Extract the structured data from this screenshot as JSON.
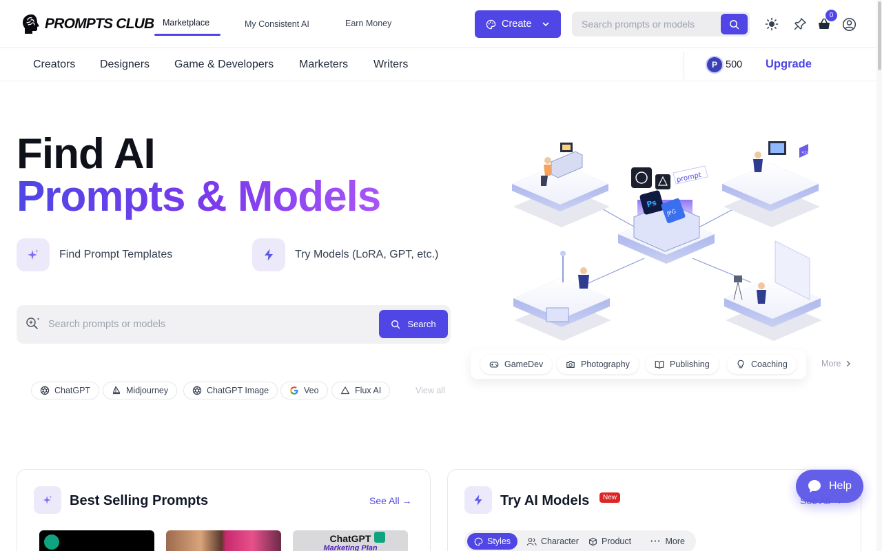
{
  "header": {
    "logo_text": "PROMPTS CLUB",
    "nav_tabs": [
      {
        "label": "Marketplace"
      },
      {
        "label": "My Consistent AI"
      },
      {
        "label": "Earn Money"
      }
    ],
    "create_label": "Create",
    "search_placeholder": "Search prompts or models",
    "cart_count": "0"
  },
  "subnav": {
    "items": [
      "Creators",
      "Designers",
      "Game & Developers",
      "Marketers",
      "Writers"
    ],
    "points": "500",
    "upgrade_label": "Upgrade"
  },
  "hero": {
    "title_line1": "Find AI",
    "title_line2": "Prompts & Models",
    "features": [
      {
        "label": "Find Prompt Templates",
        "icon": "sparkles-icon"
      },
      {
        "label": "Try Models (LoRA, GPT, etc.)",
        "icon": "lightning-icon"
      }
    ],
    "search_placeholder": "Search prompts or models",
    "search_button": "Search",
    "model_chips": [
      {
        "label": "ChatGPT",
        "icon": "openai-icon"
      },
      {
        "label": "Midjourney",
        "icon": "midjourney-icon"
      },
      {
        "label": "ChatGPT Image",
        "icon": "openai-icon"
      },
      {
        "label": "Veo",
        "icon": "google-icon"
      },
      {
        "label": "Flux AI",
        "icon": "triangle-icon"
      }
    ],
    "view_all": "View all"
  },
  "illustration": {
    "labels": [
      "prompt",
      "Ps",
      "JPG"
    ]
  },
  "categories": {
    "chips": [
      {
        "label": "GameDev",
        "icon": "gamepad-icon"
      },
      {
        "label": "Photography",
        "icon": "camera-icon"
      },
      {
        "label": "Publishing",
        "icon": "book-icon"
      },
      {
        "label": "Coaching",
        "icon": "lightbulb-icon"
      }
    ],
    "more": "More"
  },
  "cards": {
    "best_selling": {
      "title": "Best Selling Prompts",
      "see_all": "See All →",
      "thumb_text": "ChatGPT",
      "thumb_subtext": "Marketing Plan"
    },
    "ai_models": {
      "title": "Try AI Models",
      "badge": "New",
      "see_all": "See All →",
      "tabs": [
        {
          "label": "Styles",
          "active": true
        },
        {
          "label": "Character",
          "active": false
        },
        {
          "label": "Product",
          "active": false
        },
        {
          "label": "More",
          "active": false
        }
      ]
    }
  },
  "help": {
    "label": "Help"
  },
  "colors": {
    "accent": "#4f46e5",
    "gradient_start": "#4f46e5",
    "gradient_end": "#a855f7",
    "badge_red": "#dc2626"
  }
}
